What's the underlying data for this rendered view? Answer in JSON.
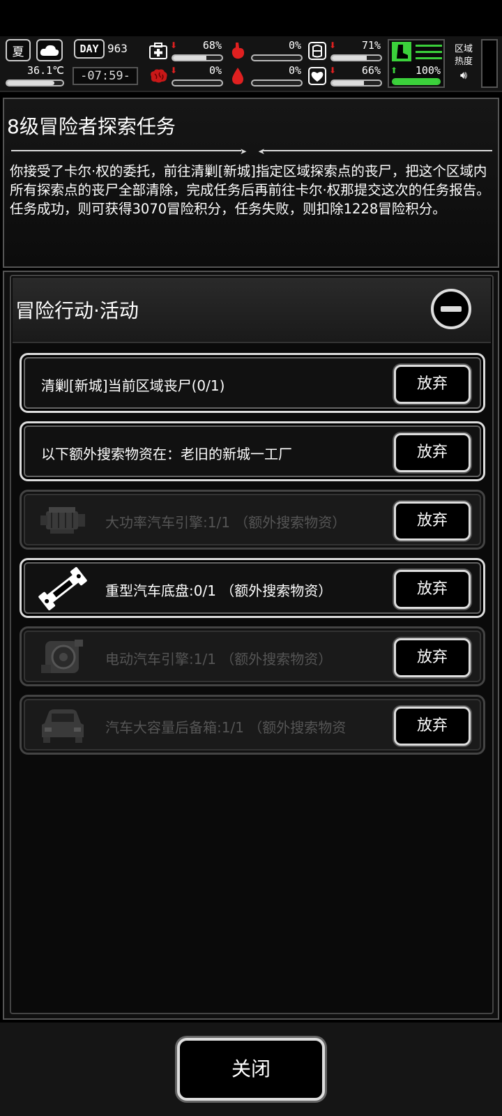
{
  "hud": {
    "season": "夏",
    "temperature": "36.1℃",
    "temperature_level": 0.85,
    "day_label": "DAY",
    "day_number": "963",
    "time": "-07:59-",
    "stats": [
      {
        "name": "health",
        "icon": "medkit-icon",
        "arrow": "down",
        "value": "68%",
        "level": 0.68
      },
      {
        "name": "hunger",
        "icon": "stomach-icon",
        "arrow": "",
        "value": "0%",
        "level": 0.0
      },
      {
        "name": "armor",
        "icon": "armor-icon",
        "arrow": "down",
        "value": "71%",
        "level": 0.71
      },
      {
        "name": "brain",
        "icon": "brain-icon",
        "arrow": "down",
        "value": "0%",
        "level": 0.0
      },
      {
        "name": "thirst",
        "icon": "blood-drop-icon",
        "arrow": "",
        "value": "0%",
        "level": 0.0
      },
      {
        "name": "mood",
        "icon": "heart-icon",
        "arrow": "down",
        "value": "66%",
        "level": 0.66
      }
    ],
    "stamina": {
      "arrow": "up",
      "value": "100%",
      "level": 1.0
    },
    "zone_heat_label": "区域\n热度",
    "colors": {
      "up": "#3bd13b",
      "down": "#e02020",
      "stamina": "#3bd13b"
    }
  },
  "quest": {
    "title": "8级冒险者探索任务",
    "description": "你接受了卡尔·权的委托，前往清剿[新城]指定区域探索点的丧尸，把这个区域内所有探索点的丧尸全部清除，完成任务后再前往卡尔·权那提交这次的任务报告。任务成功，则可获得3070冒险积分，任务失败，则扣除1228冒险积分。"
  },
  "actions": {
    "title": "冒险行动·活动",
    "abandon_label": "放弃",
    "tasks": [
      {
        "label": "清剿[新城]当前区域丧尸(0/1)",
        "state": "active",
        "icon": ""
      },
      {
        "label": "以下额外搜索物资在：老旧的新城一工厂",
        "state": "active",
        "icon": ""
      },
      {
        "label": "大功率汽车引擎:1/1 （额外搜索物资）",
        "state": "done",
        "icon": "engine-icon"
      },
      {
        "label": "重型汽车底盘:0/1 （额外搜索物资）",
        "state": "active",
        "icon": "chassis-icon"
      },
      {
        "label": "电动汽车引擎:1/1 （额外搜索物资）",
        "state": "done",
        "icon": "electric-motor-icon"
      },
      {
        "label": "汽车大容量后备箱:1/1 （额外搜索物资",
        "state": "done",
        "icon": "car-trunk-icon"
      }
    ]
  },
  "footer": {
    "close_label": "关闭"
  }
}
